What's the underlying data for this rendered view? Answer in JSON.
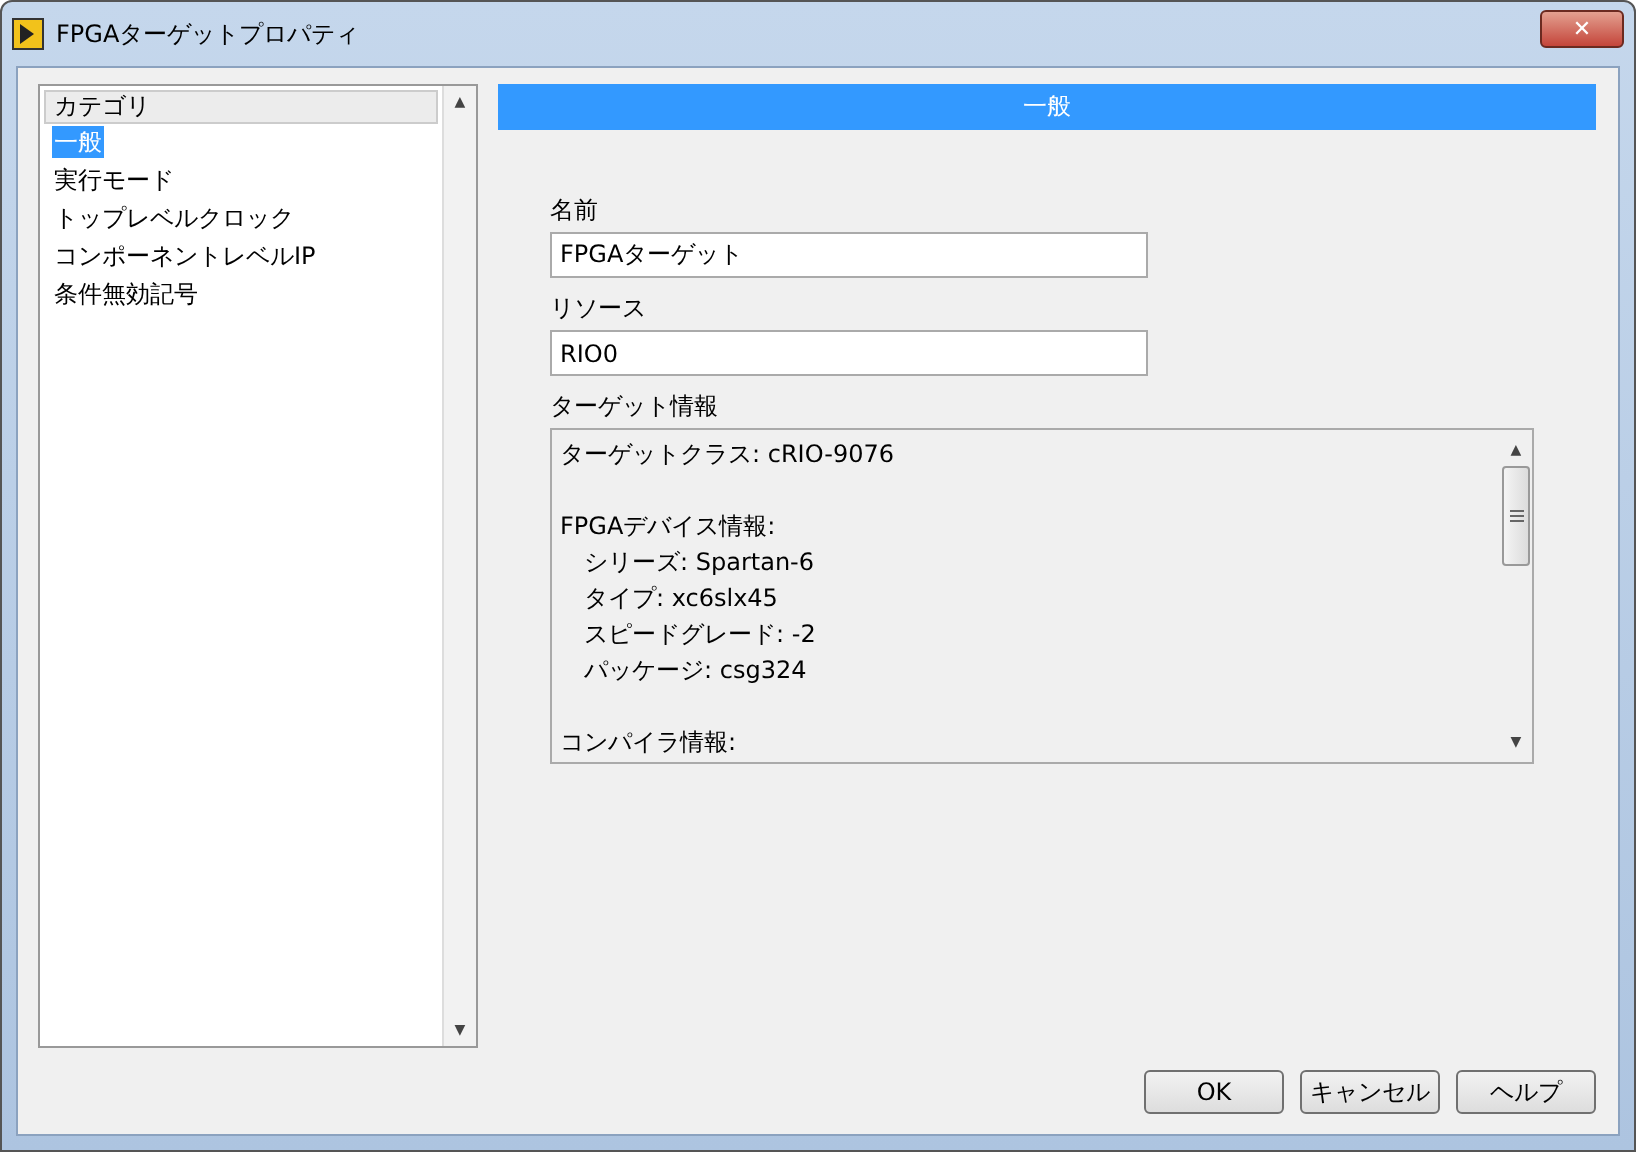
{
  "window": {
    "title": "FPGAターゲットプロパティ",
    "close": "✕"
  },
  "sidebar": {
    "header": "カテゴリ",
    "scroll_up": "▲",
    "scroll_down": "▼",
    "items": [
      {
        "label": "一般",
        "selected": true
      },
      {
        "label": "実行モード",
        "selected": false
      },
      {
        "label": "トップレベルクロック",
        "selected": false
      },
      {
        "label": "コンポーネントレベルIP",
        "selected": false
      },
      {
        "label": "条件無効記号",
        "selected": false
      }
    ]
  },
  "panel": {
    "title": "一般",
    "fields": [
      {
        "label": "名前",
        "value": "FPGAターゲット"
      },
      {
        "label": "リソース",
        "value": "RIO0"
      }
    ],
    "info": {
      "label": "ターゲット情報",
      "scroll_up": "▲",
      "scroll_down": "▼",
      "sections": [
        {
          "heading": "ターゲットクラス: cRIO-9076"
        },
        {
          "heading": "FPGAデバイス情報:",
          "lines": [
            "シリーズ: Spartan-6",
            "タイプ: xc6slx45",
            "スピードグレード: -2",
            "パッケージ: csg324"
          ]
        },
        {
          "heading": "コンパイラ情報:"
        }
      ]
    }
  },
  "buttons": [
    "OK",
    "キャンセル",
    "ヘルプ"
  ]
}
